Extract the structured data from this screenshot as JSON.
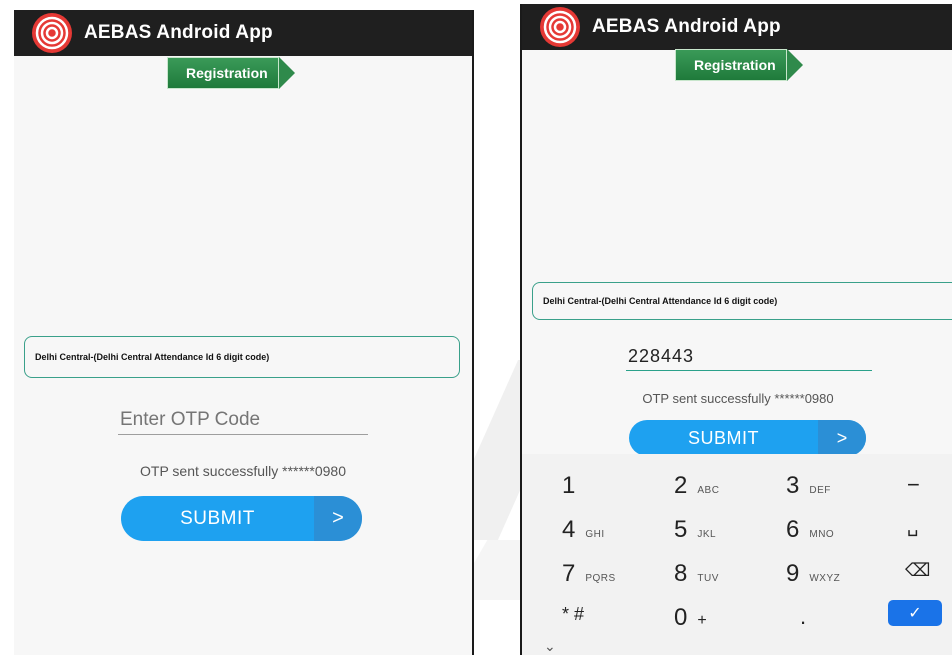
{
  "left_screen": {
    "app_title": "AEBAS Android App",
    "registration_label": "Registration",
    "organization_dropdown": "Delhi Central-(Delhi Central Attendance Id 6 digit code)",
    "otp_input": {
      "placeholder": "Enter OTP Code",
      "value": ""
    },
    "status_message": "OTP sent successfully ******0980",
    "submit_label": "SUBMIT",
    "submit_chevron": ">"
  },
  "right_screen": {
    "app_title": "AEBAS Android App",
    "registration_label": "Registration",
    "organization_dropdown": "Delhi Central-(Delhi Central Attendance Id 6 digit code)",
    "otp_input": {
      "placeholder": "Enter OTP Code",
      "value": "228443"
    },
    "status_message": "OTP sent successfully ******0980",
    "submit_label": "SUBMIT",
    "submit_chevron": ">",
    "keypad": {
      "keys": [
        {
          "digit": "1",
          "letters": ""
        },
        {
          "digit": "2",
          "letters": "ABC"
        },
        {
          "digit": "3",
          "letters": "DEF"
        },
        {
          "digit": "−",
          "letters": ""
        },
        {
          "digit": "4",
          "letters": "GHI"
        },
        {
          "digit": "5",
          "letters": "JKL"
        },
        {
          "digit": "6",
          "letters": "MNO"
        },
        {
          "digit": "␣",
          "letters": ""
        },
        {
          "digit": "7",
          "letters": "PQRS"
        },
        {
          "digit": "8",
          "letters": "TUV"
        },
        {
          "digit": "9",
          "letters": "WXYZ"
        },
        {
          "digit": "⌫",
          "letters": ""
        },
        {
          "digit": "* #",
          "letters": ""
        },
        {
          "digit": "0",
          "letters": "+"
        },
        {
          "digit": ".",
          "letters": ""
        },
        {
          "digit": "✓",
          "letters": ""
        }
      ],
      "collapse_chevron": "⌄"
    }
  },
  "colors": {
    "appbar": "#1f1f1f",
    "registration_green": "#1f7a3b",
    "submit_blue": "#1ea1f0",
    "dropdown_border": "#3aa08a",
    "done_key_blue": "#1a73e8"
  }
}
